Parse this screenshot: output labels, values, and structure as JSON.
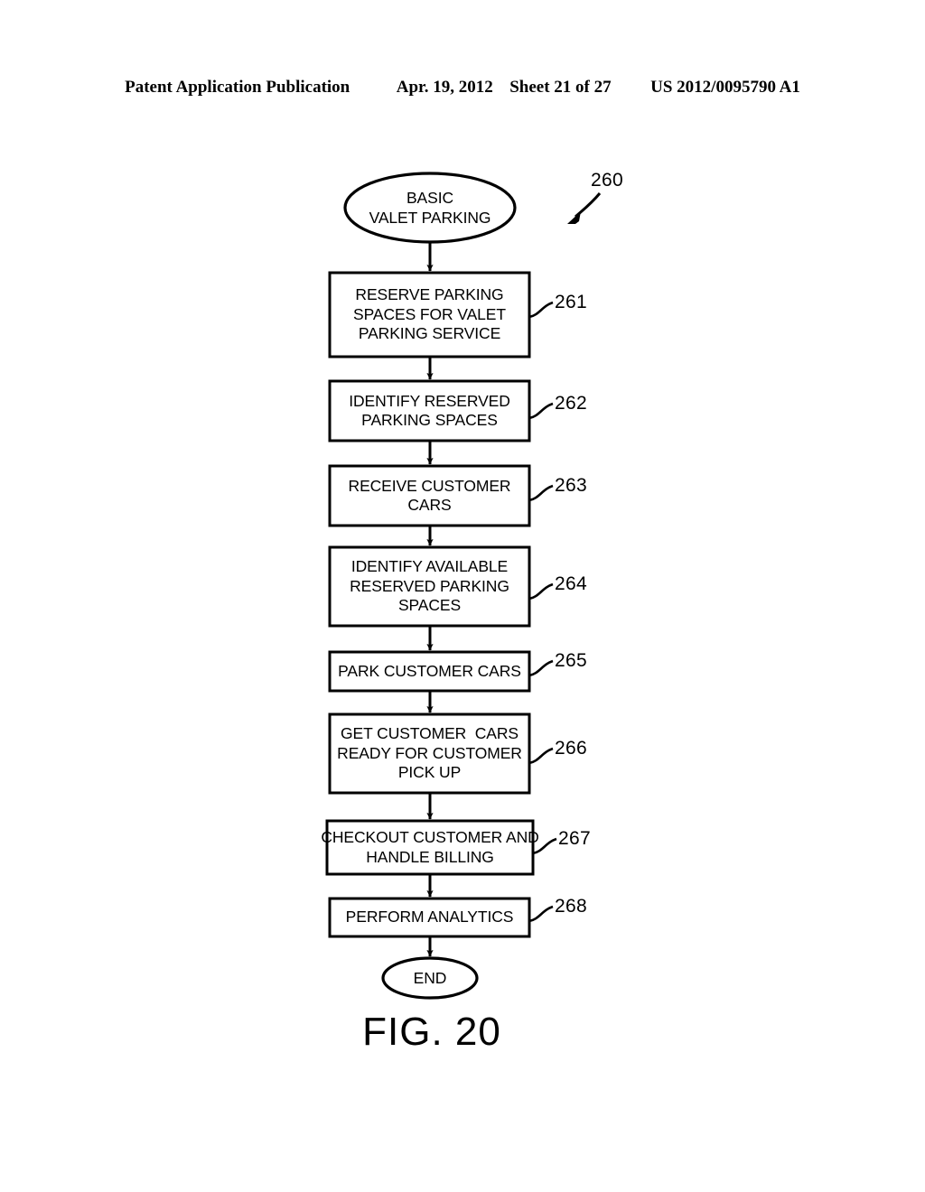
{
  "header": {
    "publication": "Patent Application Publication",
    "date": "Apr. 19, 2012",
    "sheet": "Sheet 21 of 27",
    "patent_number": "US 2012/0095790 A1"
  },
  "figure": {
    "caption": "FIG. 20",
    "diagram_ref": "260"
  },
  "flowchart": {
    "start": {
      "ref": "260",
      "line1": "BASIC",
      "line2": "VALET PARKING"
    },
    "end": {
      "label": "END"
    },
    "steps": [
      {
        "ref": "261",
        "lines": [
          "RESERVE PARKING",
          "SPACES FOR VALET",
          "PARKING SERVICE"
        ]
      },
      {
        "ref": "262",
        "lines": [
          "IDENTIFY RESERVED",
          "PARKING SPACES"
        ]
      },
      {
        "ref": "263",
        "lines": [
          "RECEIVE CUSTOMER",
          "CARS"
        ]
      },
      {
        "ref": "264",
        "lines": [
          "IDENTIFY AVAILABLE",
          "RESERVED PARKING",
          "SPACES"
        ]
      },
      {
        "ref": "265",
        "lines": [
          "PARK CUSTOMER CARS"
        ]
      },
      {
        "ref": "266",
        "lines": [
          "GET CUSTOMER  CARS",
          "READY FOR CUSTOMER",
          "PICK UP"
        ]
      },
      {
        "ref": "267",
        "lines": [
          "CHECKOUT CUSTOMER AND",
          "HANDLE BILLING"
        ]
      },
      {
        "ref": "268",
        "lines": [
          "PERFORM ANALYTICS"
        ]
      }
    ]
  },
  "colors": {
    "ink": "#000000",
    "paper": "#ffffff"
  }
}
